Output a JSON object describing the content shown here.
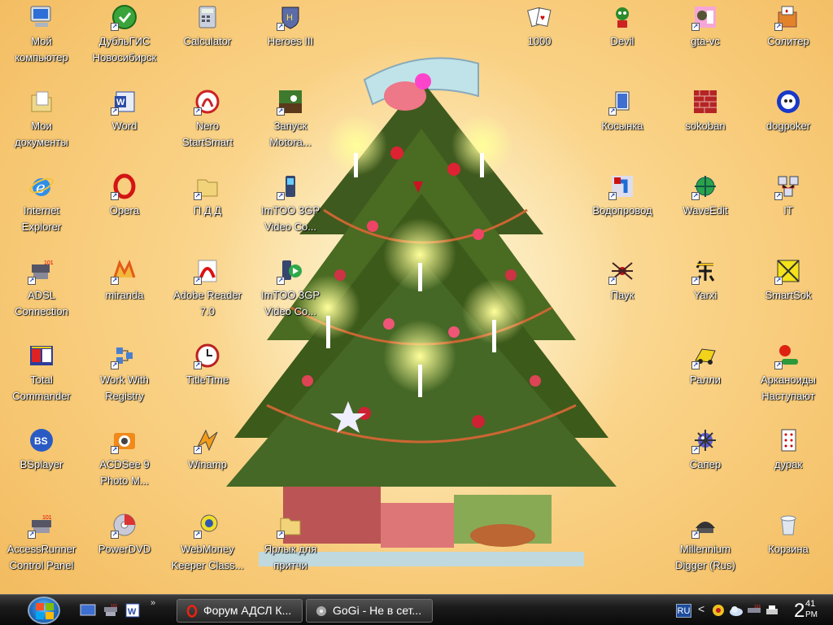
{
  "desktop_icons": [
    {
      "label": "Мой\nкомпьютер",
      "icon": "my-computer-icon"
    },
    {
      "label": "Мои\nдокументы",
      "icon": "my-documents-icon"
    },
    {
      "label": "Internet\nExplorer",
      "icon": "internet-explorer-icon"
    },
    {
      "label": "ADSL\nConnection",
      "icon": "network-connection-icon"
    },
    {
      "label": "Total\nCommander",
      "icon": "total-commander-icon"
    },
    {
      "label": "BSplayer",
      "icon": "bsplayer-icon"
    },
    {
      "label": "AccessRunner\nControl Panel",
      "icon": "modem-icon"
    },
    {
      "label": "ДубльГИС\nНовосибирск",
      "icon": "dublgis-icon"
    },
    {
      "label": "Word",
      "icon": "word-icon"
    },
    {
      "label": "Opera",
      "icon": "opera-icon"
    },
    {
      "label": "miranda",
      "icon": "miranda-icon"
    },
    {
      "label": "Work With\nRegistry",
      "icon": "registry-icon"
    },
    {
      "label": "ACDSee 9\nPhoto M...",
      "icon": "acdsee-icon"
    },
    {
      "label": "PowerDVD",
      "icon": "powerdvd-icon"
    },
    {
      "label": "Calculator",
      "icon": "calculator-icon"
    },
    {
      "label": "Nero\nStartSmart",
      "icon": "nero-icon"
    },
    {
      "label": "П Д Д",
      "icon": "folder-icon"
    },
    {
      "label": "Adobe Reader\n7.0",
      "icon": "adobe-reader-icon"
    },
    {
      "label": "TitleTime",
      "icon": "clock-icon"
    },
    {
      "label": "Winamp",
      "icon": "winamp-icon"
    },
    {
      "label": "WebMoney\nKeeper Class...",
      "icon": "webmoney-icon"
    },
    {
      "label": "Heroes III",
      "icon": "heroes-icon"
    },
    {
      "label": "Запуск\nMotora...",
      "icon": "motorola-icon"
    },
    {
      "label": "ImTOO 3GP\nVideo Co...",
      "icon": "imtoo-phone-icon"
    },
    {
      "label": "ImTOO 3GP\nVideo Co...",
      "icon": "imtoo-converter-icon"
    },
    {
      "label": "Ярлык для\nпритчи",
      "icon": "shortcut-file-icon"
    },
    {
      "label": "1000",
      "icon": "cards-icon"
    },
    {
      "label": "Devil",
      "icon": "devil-icon"
    },
    {
      "label": "Косынка",
      "icon": "solitaire-icon"
    },
    {
      "label": "Водопровод",
      "icon": "pipes-icon"
    },
    {
      "label": "Паук",
      "icon": "spider-icon"
    },
    {
      "label": "gta-vc",
      "icon": "gta-icon"
    },
    {
      "label": "sokoban",
      "icon": "sokoban-icon"
    },
    {
      "label": "WaveEdit",
      "icon": "waveedit-icon"
    },
    {
      "label": "Yarxi",
      "icon": "yarxi-icon"
    },
    {
      "label": "Ралли",
      "icon": "rally-icon"
    },
    {
      "label": "Сапер",
      "icon": "minesweeper-icon"
    },
    {
      "label": "Millennium\nDigger (Rus)",
      "icon": "digger-icon"
    },
    {
      "label": "Солитер",
      "icon": "solitaire-box-icon"
    },
    {
      "label": "dogpoker",
      "icon": "dogpoker-icon"
    },
    {
      "label": "IT",
      "icon": "it-icon"
    },
    {
      "label": "SmartSok",
      "icon": "smartsok-icon"
    },
    {
      "label": "Арканоиды\nНаступают",
      "icon": "arkanoid-icon"
    },
    {
      "label": "дурак",
      "icon": "card-icon"
    },
    {
      "label": "Корзина",
      "icon": "recycle-bin-icon"
    }
  ],
  "taskbar": {
    "quick_launch": [
      "show-desktop-icon",
      "network-icon",
      "word-icon"
    ],
    "quick_launch_more": "»",
    "tasks": [
      {
        "label": "Форум АДСЛ К...",
        "icon": "opera-icon"
      },
      {
        "label": "GoGi - Не в сет...",
        "icon": "miranda-icon"
      }
    ],
    "tray": {
      "language": "RU",
      "arrow": "<",
      "icons": [
        "antivirus-icon",
        "cloud-icon",
        "network-tray-icon",
        "printer-icon"
      ],
      "clock_hour": "2",
      "clock_minutes": "41",
      "clock_ampm": "PM"
    }
  },
  "colors": {
    "desktop_background": "#f6c56f",
    "taskbar": "#1b1b1b",
    "icon_label": "#ffffff"
  }
}
